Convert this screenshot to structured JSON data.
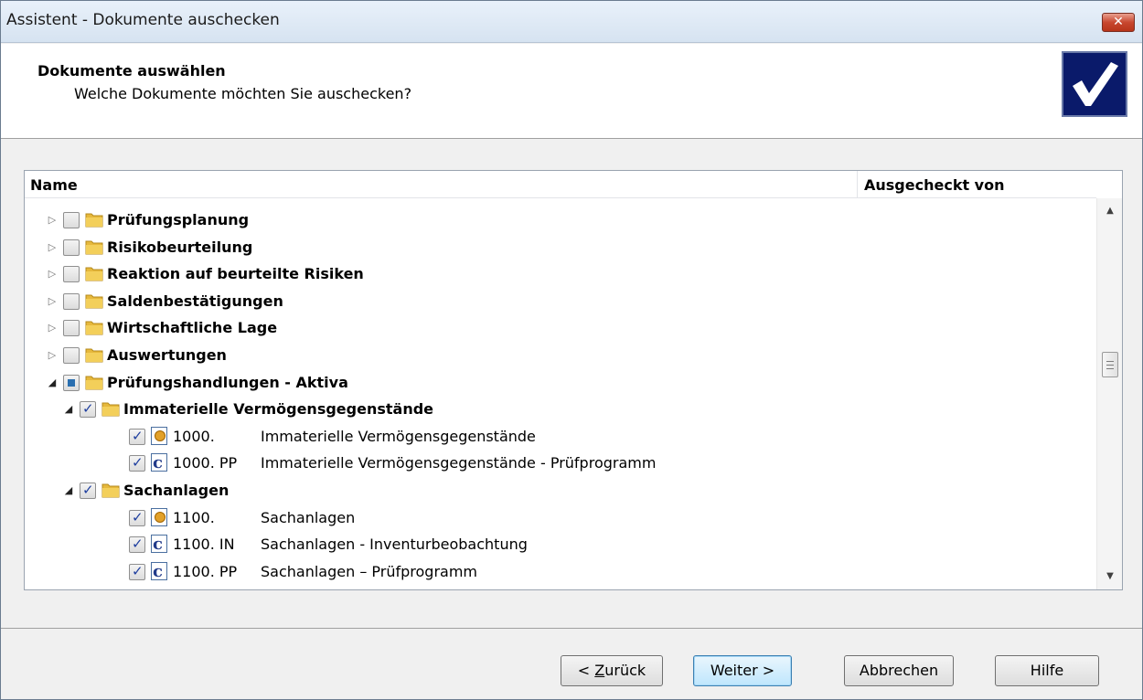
{
  "window": {
    "title": "Assistent - Dokumente auschecken",
    "close_label": "✕"
  },
  "header": {
    "title": "Dokumente auswählen",
    "subtitle": "Welche Dokumente möchten Sie auschecken?",
    "logo_icon": "checkmark-icon"
  },
  "tree": {
    "columns": [
      "Name",
      "Ausgecheckt von"
    ],
    "rows": [
      {
        "label": "Prüfungsplanung",
        "type": "folder",
        "expanded": false,
        "checked": "none"
      },
      {
        "label": "Risikobeurteilung",
        "type": "folder",
        "expanded": false,
        "checked": "none"
      },
      {
        "label": "Reaktion auf beurteilte Risiken",
        "type": "folder",
        "expanded": false,
        "checked": "none"
      },
      {
        "label": "Saldenbestätigungen",
        "type": "folder",
        "expanded": false,
        "checked": "none"
      },
      {
        "label": "Wirtschaftliche Lage",
        "type": "folder",
        "expanded": false,
        "checked": "none"
      },
      {
        "label": "Auswertungen",
        "type": "folder",
        "expanded": false,
        "checked": "none"
      },
      {
        "label": "Prüfungshandlungen - Aktiva",
        "type": "folder",
        "expanded": true,
        "checked": "partial"
      },
      {
        "label": "Immaterielle Vermögensgegenstände",
        "type": "folder",
        "expanded": true,
        "checked": "checked"
      },
      {
        "label": "1000.",
        "type": "workpaper",
        "description": "Immaterielle Vermögensgegenstände",
        "checked": "checked"
      },
      {
        "label": "1000. PP",
        "type": "checklist",
        "description": "Immaterielle Vermögensgegenstände - Prüfprogramm",
        "checked": "checked"
      },
      {
        "label": "Sachanlagen",
        "type": "folder",
        "expanded": true,
        "checked": "checked"
      },
      {
        "label": "1100.",
        "type": "workpaper",
        "description": "Sachanlagen",
        "checked": "checked"
      },
      {
        "label": "1100. IN",
        "type": "checklist",
        "description": "Sachanlagen - Inventurbeobachtung",
        "checked": "checked"
      },
      {
        "label": "1100. PP",
        "type": "checklist",
        "description": "Sachanlagen – Prüfprogramm",
        "checked": "checked"
      }
    ]
  },
  "buttons": {
    "back": "< Zurück",
    "back_prefix": "< ",
    "back_mnemonic": "Z",
    "back_rest": "urück",
    "next": "Weiter >",
    "cancel": "Abbrechen",
    "help": "Hilfe"
  },
  "colors": {
    "titlebar": "#dce7f3",
    "close": "#c8472f",
    "logo_bg": "#0a1a6a",
    "folder": "#e6b83c",
    "check": "#1f3f9f"
  }
}
